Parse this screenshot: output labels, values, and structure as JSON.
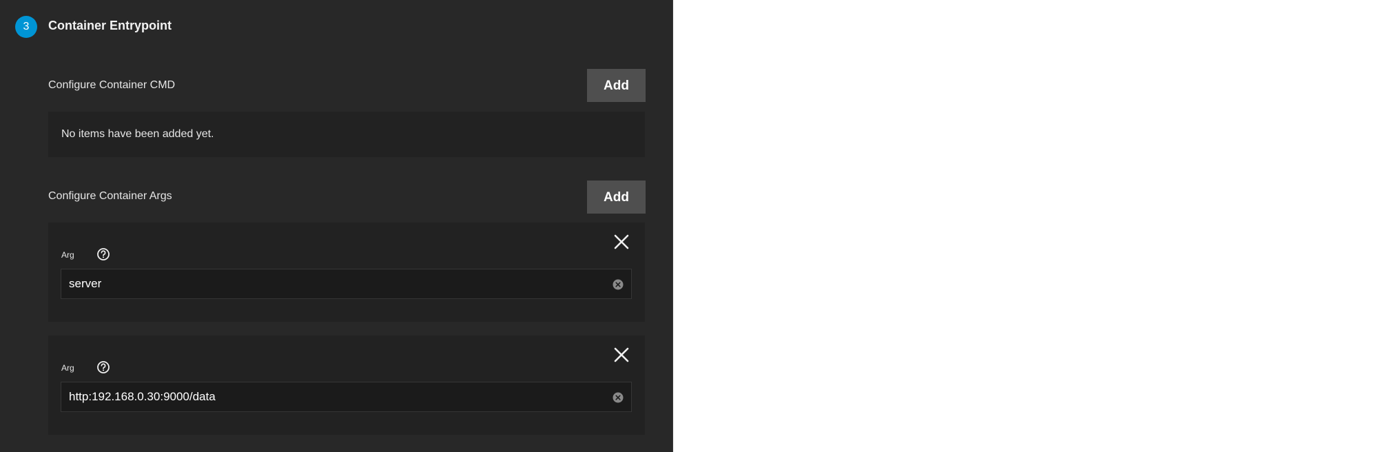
{
  "step": {
    "number": "3",
    "title": "Container Entrypoint"
  },
  "cmd_section": {
    "label": "Configure Container CMD",
    "add_label": "Add",
    "empty_text": "No items have been added yet."
  },
  "args_section": {
    "label": "Configure Container Args",
    "add_label": "Add",
    "items": [
      {
        "label": "Arg",
        "value": "server"
      },
      {
        "label": "Arg",
        "value": "http:192.168.0.30:9000/data"
      }
    ]
  },
  "icons": {
    "help": "help-circle-icon",
    "remove": "close-icon",
    "clear": "clear-circle-icon"
  },
  "colors": {
    "panel_bg": "#282828",
    "card_bg": "#222222",
    "accent": "#0095d5",
    "button_bg": "#4f4f4f"
  }
}
